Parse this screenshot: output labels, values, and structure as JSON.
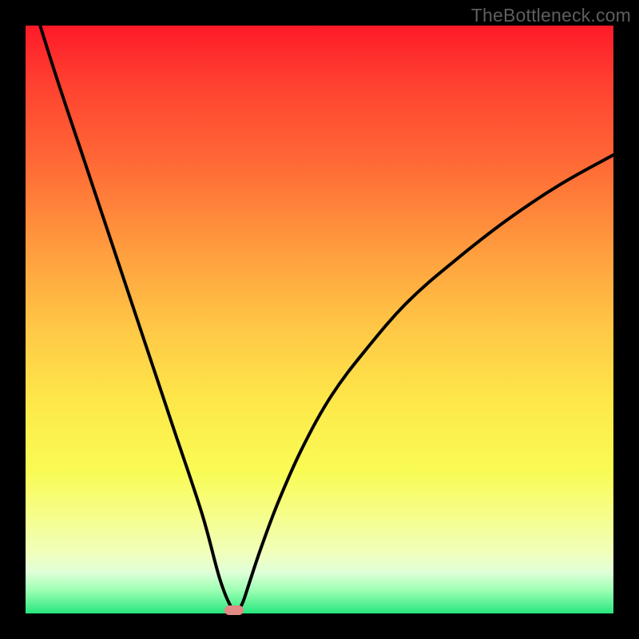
{
  "watermark": "TheBottleneck.com",
  "chart_data": {
    "type": "line",
    "title": "",
    "xlabel": "",
    "ylabel": "",
    "xlim": [
      0,
      100
    ],
    "ylim": [
      0,
      100
    ],
    "grid": false,
    "legend": false,
    "series": [
      {
        "name": "left-branch",
        "x": [
          0,
          5,
          10,
          15,
          20,
          25,
          30,
          33,
          35,
          36
        ],
        "values": [
          108,
          92,
          77,
          62,
          47,
          32,
          17,
          6,
          1,
          0
        ]
      },
      {
        "name": "right-branch",
        "x": [
          36,
          37,
          38,
          40,
          43,
          47,
          52,
          58,
          65,
          73,
          82,
          91,
          100
        ],
        "values": [
          0,
          2,
          5,
          11,
          19,
          28,
          37,
          45,
          53,
          60,
          67,
          73,
          78
        ]
      }
    ],
    "marker": {
      "x": 35.5,
      "y": 0.5,
      "color": "#e18a86"
    },
    "gradient_stops": [
      {
        "pos": 0,
        "color": "#fe1a28"
      },
      {
        "pos": 24,
        "color": "#ff6b36"
      },
      {
        "pos": 52,
        "color": "#ffc946"
      },
      {
        "pos": 76,
        "color": "#f9fb55"
      },
      {
        "pos": 100,
        "color": "#27e77e"
      }
    ]
  }
}
